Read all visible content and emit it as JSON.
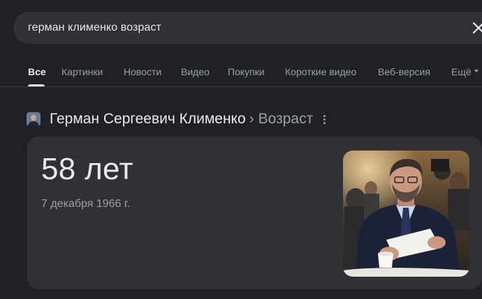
{
  "search": {
    "query": "герман клименко возраст",
    "clear_icon": "close-icon"
  },
  "tabs": [
    {
      "label": "Все",
      "active": true
    },
    {
      "label": "Картинки",
      "active": false
    },
    {
      "label": "Новости",
      "active": false
    },
    {
      "label": "Видео",
      "active": false
    },
    {
      "label": "Покупки",
      "active": false
    },
    {
      "label": "Короткие видео",
      "active": false
    },
    {
      "label": "Веб-версия",
      "active": false
    },
    {
      "label": "Ещё",
      "active": false,
      "icon": "chevron-down-icon"
    }
  ],
  "knowledge": {
    "entity": "Герман Сергеевич Клименко",
    "separator": "›",
    "attribute": "Возраст",
    "menu_icon": "more-vert-icon",
    "value": "58 лет",
    "date": "7 декабря 1966 г.",
    "photo_icon": "person-photo"
  },
  "colors": {
    "background": "#202124",
    "surface": "#303134",
    "text_primary": "#e8eaed",
    "text_secondary": "#9aa0a6"
  }
}
